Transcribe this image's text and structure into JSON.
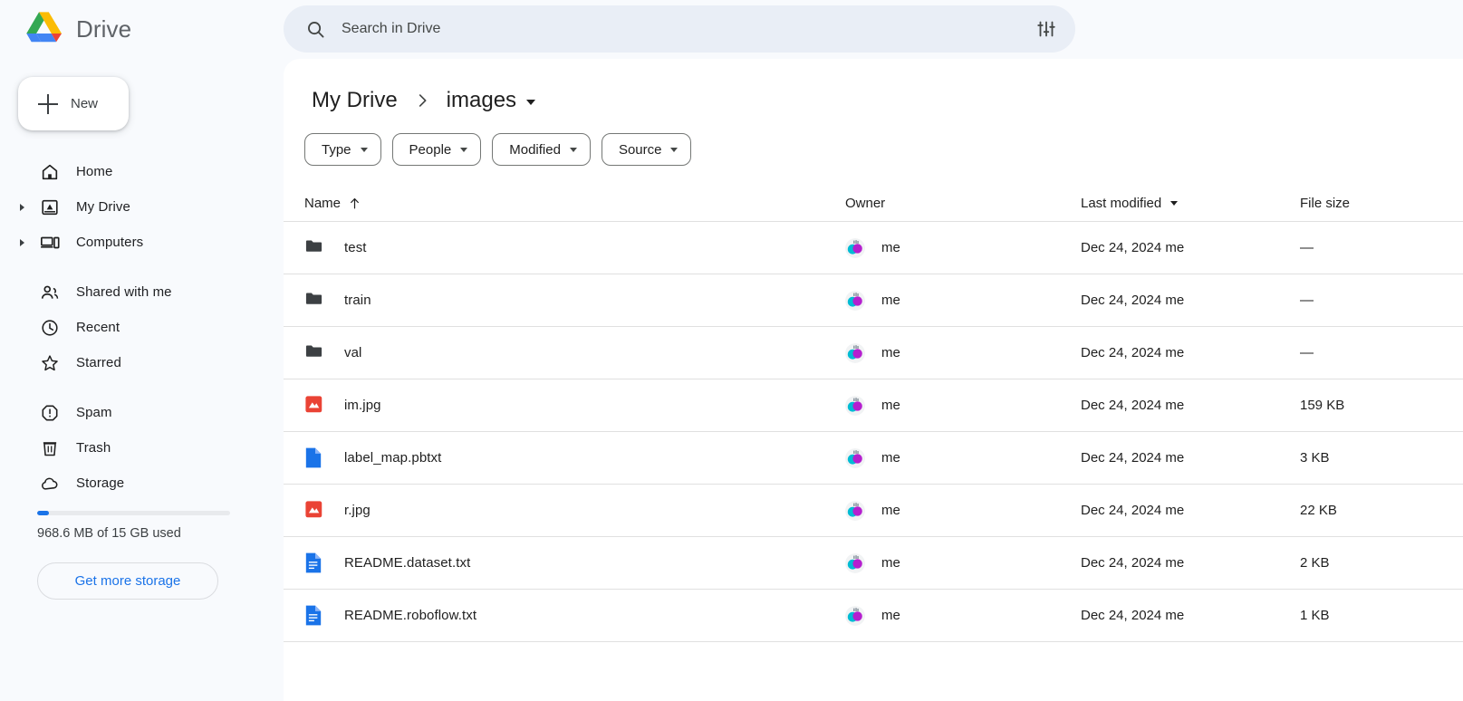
{
  "brand": {
    "name": "Drive",
    "logo_icon": "drive-logo-icon"
  },
  "sidebar": {
    "new_button": {
      "label": "New",
      "icon": "plus-icon"
    },
    "groups": [
      {
        "items": [
          {
            "label": "Home",
            "icon": "home-icon",
            "expandable": false
          },
          {
            "label": "My Drive",
            "icon": "drive-outline-icon",
            "expandable": true
          },
          {
            "label": "Computers",
            "icon": "computers-icon",
            "expandable": true
          }
        ]
      },
      {
        "items": [
          {
            "label": "Shared with me",
            "icon": "people-icon",
            "expandable": false
          },
          {
            "label": "Recent",
            "icon": "clock-icon",
            "expandable": false
          },
          {
            "label": "Starred",
            "icon": "star-icon",
            "expandable": false
          }
        ]
      },
      {
        "items": [
          {
            "label": "Spam",
            "icon": "spam-icon",
            "expandable": false
          },
          {
            "label": "Trash",
            "icon": "trash-icon",
            "expandable": false
          },
          {
            "label": "Storage",
            "icon": "cloud-icon",
            "expandable": false
          }
        ]
      }
    ],
    "storage": {
      "used_text": "968.6 MB of 15 GB used",
      "percent": 6,
      "fill_color": "#1a73e8",
      "track_color": "#e8eaed",
      "button_label": "Get more storage"
    }
  },
  "search": {
    "placeholder": "Search in Drive",
    "value": "",
    "icon": "search-icon",
    "options_icon": "tune-icon"
  },
  "breadcrumb": {
    "root": "My Drive",
    "separator_icon": "chevron-right-icon",
    "current": "images",
    "caret_icon": "caret-down-icon"
  },
  "filters": [
    {
      "label": "Type"
    },
    {
      "label": "People"
    },
    {
      "label": "Modified"
    },
    {
      "label": "Source"
    }
  ],
  "table": {
    "columns": {
      "name": "Name",
      "owner": "Owner",
      "modified": "Last modified",
      "size": "File size"
    },
    "sort": {
      "column": "Name",
      "direction": "asc",
      "icon": "arrow-up-icon"
    },
    "modified_sort_icon": "caret-down-icon",
    "rows": [
      {
        "name": "test",
        "icon": "folder-icon",
        "owner": "me",
        "modified": "Dec 24, 2024 me",
        "size": "—"
      },
      {
        "name": "train",
        "icon": "folder-icon",
        "owner": "me",
        "modified": "Dec 24, 2024 me",
        "size": "—"
      },
      {
        "name": "val",
        "icon": "folder-icon",
        "owner": "me",
        "modified": "Dec 24, 2024 me",
        "size": "—"
      },
      {
        "name": "im.jpg",
        "icon": "image-file-icon",
        "owner": "me",
        "modified": "Dec 24, 2024 me",
        "size": "159 KB"
      },
      {
        "name": "label_map.pbtxt",
        "icon": "generic-file-icon",
        "owner": "me",
        "modified": "Dec 24, 2024 me",
        "size": "3 KB"
      },
      {
        "name": "r.jpg",
        "icon": "image-file-icon",
        "owner": "me",
        "modified": "Dec 24, 2024 me",
        "size": "22 KB"
      },
      {
        "name": "README.dataset.txt",
        "icon": "text-file-icon",
        "owner": "me",
        "modified": "Dec 24, 2024 me",
        "size": "2 KB"
      },
      {
        "name": "README.roboflow.txt",
        "icon": "text-file-icon",
        "owner": "me",
        "modified": "Dec 24, 2024 me",
        "size": "1 KB"
      }
    ]
  },
  "colors": {
    "page_background": "#f8fafd",
    "panel_background": "#ffffff",
    "search_background": "#e9eef6",
    "accent_blue": "#1a73e8",
    "image_icon_red": "#ea4335",
    "file_icon_blue": "#1a73e8",
    "folder_gray": "#3c4043",
    "divider": "#e0e0e0"
  }
}
